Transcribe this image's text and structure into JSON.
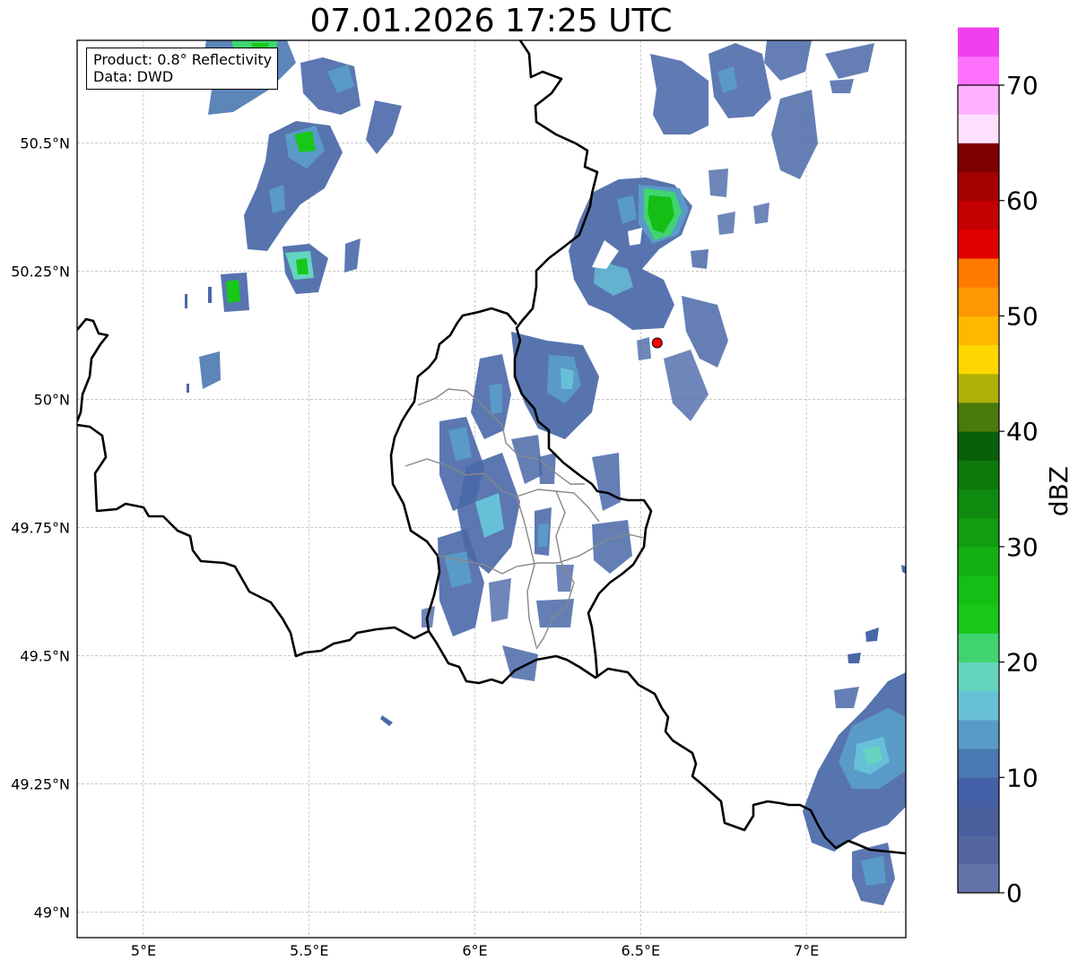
{
  "title": "07.01.2026 17:25 UTC",
  "info": {
    "product": "Product: 0.8° Reflectivity",
    "data": "Data: DWD"
  },
  "map": {
    "lon_range": [
      4.8,
      7.3
    ],
    "lat_range": [
      48.95,
      50.7
    ],
    "lon_ticks": [
      {
        "value": 5.0,
        "label": "5°E"
      },
      {
        "value": 5.5,
        "label": "5.5°E"
      },
      {
        "value": 6.0,
        "label": "6°E"
      },
      {
        "value": 6.5,
        "label": "6.5°E"
      },
      {
        "value": 7.0,
        "label": "7°E"
      }
    ],
    "lat_ticks": [
      {
        "value": 49.0,
        "label": "49°N"
      },
      {
        "value": 49.25,
        "label": "49.25°N"
      },
      {
        "value": 49.5,
        "label": "49.5°N"
      },
      {
        "value": 49.75,
        "label": "49.75°N"
      },
      {
        "value": 50.0,
        "label": "50°N"
      },
      {
        "value": 50.25,
        "label": "50.25°N"
      },
      {
        "value": 50.5,
        "label": "50.5°N"
      }
    ],
    "radar_site": {
      "lon": 6.55,
      "lat": 50.11,
      "color": "#ff0000"
    },
    "gridlines": true
  },
  "colorbar": {
    "label": "dBZ",
    "range": [
      0,
      70
    ],
    "step": 2.5,
    "ticks": [
      {
        "value": 0,
        "label": "0"
      },
      {
        "value": 10,
        "label": "10"
      },
      {
        "value": 20,
        "label": "20"
      },
      {
        "value": 30,
        "label": "30"
      },
      {
        "value": 40,
        "label": "40"
      },
      {
        "value": 50,
        "label": "50"
      },
      {
        "value": 60,
        "label": "60"
      },
      {
        "value": 70,
        "label": "70"
      }
    ],
    "colors": [
      "#6474a8",
      "#5466a0",
      "#4a5e9e",
      "#4460a8",
      "#4a78b0",
      "#5a9ac8",
      "#68c0d8",
      "#64d4c0",
      "#40d470",
      "#18c818",
      "#14be14",
      "#12b012",
      "#109e10",
      "#0e8a0e",
      "#0c780c",
      "#0a600a",
      "#4a7a0a",
      "#b0b00a",
      "#ffd600",
      "#ffb800",
      "#ff9800",
      "#ff7a00",
      "#e00000",
      "#c40000",
      "#a40000",
      "#7e0000",
      "#ffe0ff",
      "#ffb0ff",
      "#ff70ff",
      "#ee40ee"
    ]
  }
}
